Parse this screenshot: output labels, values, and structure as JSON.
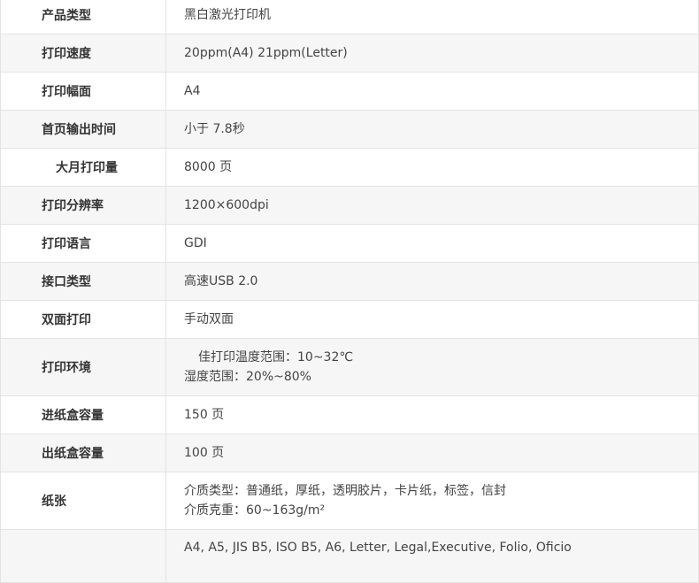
{
  "specs": [
    {
      "label": "产品类型",
      "values": [
        "黑白激光打印机"
      ]
    },
    {
      "label": "打印速度",
      "values": [
        "20ppm(A4) 21ppm(Letter)"
      ]
    },
    {
      "label": "打印幅面",
      "values": [
        "A4"
      ]
    },
    {
      "label": "首页输出时间",
      "values": [
        "小于 7.8秒"
      ]
    },
    {
      "label": "大月打印量",
      "values": [
        "8000 页"
      ]
    },
    {
      "label": "打印分辨率",
      "values": [
        "1200×600dpi"
      ]
    },
    {
      "label": "打印语言",
      "values": [
        "GDI"
      ]
    },
    {
      "label": "接口类型",
      "values": [
        "高速USB 2.0"
      ]
    },
    {
      "label": "双面打印",
      "values": [
        "手动双面"
      ]
    },
    {
      "label": "打印环境",
      "values": [
        "佳打印温度范围：10~32℃",
        "湿度范围：20%~80%"
      ]
    },
    {
      "label": "进纸盒容量",
      "values": [
        "150 页"
      ]
    },
    {
      "label": "出纸盒容量",
      "values": [
        "100 页"
      ]
    },
    {
      "label": "纸张",
      "values": [
        "介质类型：普通纸，厚纸，透明胶片，卡片纸，标签，信封",
        "介质克重：60~163g/m²"
      ]
    },
    {
      "label": "",
      "values": [
        "A4, A5, JIS B5, ISO B5, A6, Letter, Legal,Executive, Folio, Oficio"
      ]
    }
  ]
}
